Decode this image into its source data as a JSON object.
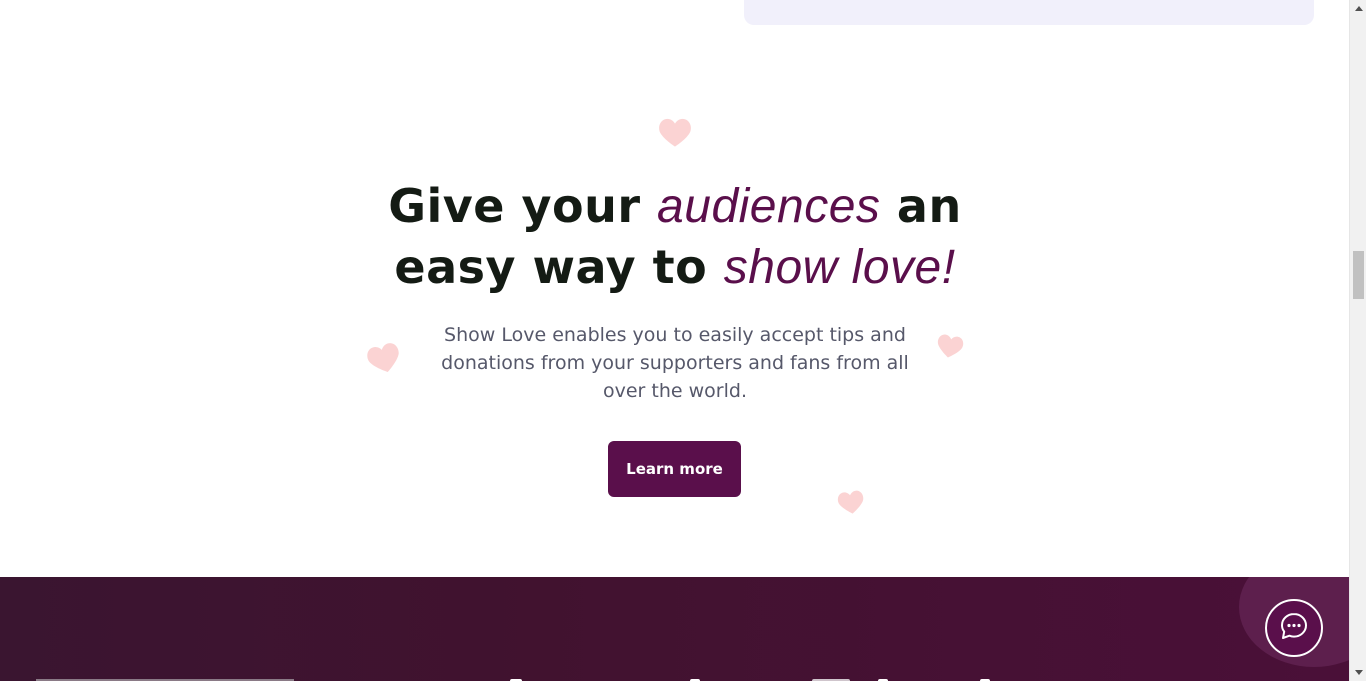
{
  "colors": {
    "accent": "#5a0f4b",
    "heading": "#141b14",
    "body_text": "#56586a",
    "heart": "#fbd3d3",
    "footer_bg": "#41122f"
  },
  "hero": {
    "headline_part1": "Give your ",
    "headline_em1": "audiences",
    "headline_part2": " an easy way to ",
    "headline_em2": "show love!",
    "description": "Show Love enables you to easily accept tips and donations from your supporters and fans from all over the world.",
    "cta_label": "Learn more"
  },
  "decor": {
    "heart_icon": "heart-icon"
  },
  "chat": {
    "icon": "chat-bubble-icon"
  }
}
